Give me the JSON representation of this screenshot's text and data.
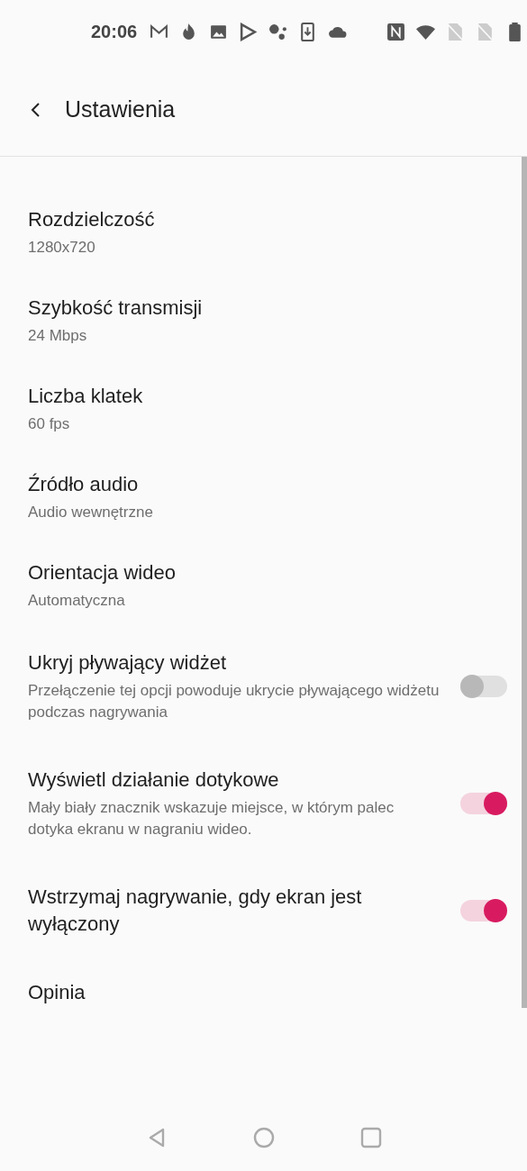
{
  "status_bar": {
    "time": "20:06"
  },
  "header": {
    "title": "Ustawienia"
  },
  "settings": [
    {
      "kind": "value",
      "title": "Rozdzielczość",
      "summary": "1280x720"
    },
    {
      "kind": "value",
      "title": "Szybkość transmisji",
      "summary": "24 Mbps"
    },
    {
      "kind": "value",
      "title": "Liczba klatek",
      "summary": "60 fps"
    },
    {
      "kind": "value",
      "title": "Źródło audio",
      "summary": "Audio wewnętrzne"
    },
    {
      "kind": "value",
      "title": "Orientacja wideo",
      "summary": "Automatyczna"
    },
    {
      "kind": "toggle",
      "title": "Ukryj pływający widżet",
      "summary": "Przełączenie tej opcji powoduje ukrycie pływającego widżetu podczas nagrywania",
      "on": false
    },
    {
      "kind": "toggle",
      "title": "Wyświetl działanie dotykowe",
      "summary": "Mały biały znacznik wskazuje miejsce, w którym palec dotyka ekranu w nagraniu wideo.",
      "on": true
    },
    {
      "kind": "toggle",
      "title": "Wstrzymaj nagrywanie, gdy ekran jest wyłączony",
      "on": true
    },
    {
      "kind": "link",
      "title": "Opinia"
    }
  ]
}
